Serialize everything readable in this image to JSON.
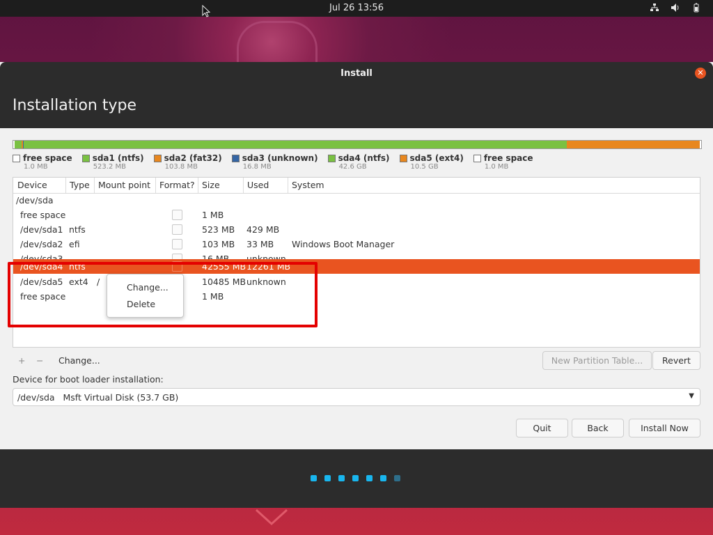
{
  "topbar": {
    "clock": "Jul 26  13:56",
    "icons": [
      "network-icon",
      "volume-icon",
      "battery-icon"
    ]
  },
  "window": {
    "title": "Install",
    "page_title": "Installation type"
  },
  "partition_bar": [
    {
      "label": "free space",
      "size": "1.0 MB",
      "color": "#ffffff"
    },
    {
      "label": "sda1 (ntfs)",
      "size": "523.2 MB",
      "color": "#7ac142"
    },
    {
      "label": "sda2 (fat32)",
      "size": "103.8 MB",
      "color": "#e8871e"
    },
    {
      "label": "sda3 (unknown)",
      "size": "16.8 MB",
      "color": "#3465a4"
    },
    {
      "label": "sda4 (ntfs)",
      "size": "42.6 GB",
      "color": "#7ac142"
    },
    {
      "label": "sda5 (ext4)",
      "size": "10.5 GB",
      "color": "#e8871e"
    },
    {
      "label": "free space",
      "size": "1.0 MB",
      "color": "#ffffff"
    }
  ],
  "table": {
    "headers": [
      "Device",
      "Type",
      "Mount point",
      "Format?",
      "Size",
      "Used",
      "System"
    ],
    "rows": [
      {
        "device": "/dev/sda",
        "type": "",
        "mount": "",
        "format": false,
        "size": "",
        "used": "",
        "system": "",
        "group": true
      },
      {
        "device": "free space",
        "type": "",
        "mount": "",
        "format": true,
        "size": "1 MB",
        "used": "",
        "system": ""
      },
      {
        "device": "/dev/sda1",
        "type": "ntfs",
        "mount": "",
        "format": true,
        "size": "523 MB",
        "used": "429 MB",
        "system": ""
      },
      {
        "device": "/dev/sda2",
        "type": "efi",
        "mount": "",
        "format": true,
        "size": "103 MB",
        "used": "33 MB",
        "system": "Windows Boot Manager"
      },
      {
        "device": "/dev/sda3",
        "type": "",
        "mount": "",
        "format": true,
        "size": "16 MB",
        "used": "unknown",
        "system": ""
      },
      {
        "device": "/dev/sda4",
        "type": "ntfs",
        "mount": "",
        "format": true,
        "size": "42555 MB",
        "used": "12261 MB",
        "system": "",
        "selected": true
      },
      {
        "device": "/dev/sda5",
        "type": "ext4",
        "mount": "/",
        "format": true,
        "size": "10485 MB",
        "used": "unknown",
        "system": ""
      },
      {
        "device": "free space",
        "type": "",
        "mount": "",
        "format": true,
        "size": "1 MB",
        "used": "",
        "system": ""
      }
    ]
  },
  "context_menu": {
    "change": "Change...",
    "delete": "Delete"
  },
  "toolbar": {
    "add": "+",
    "remove": "−",
    "change": "Change...",
    "new_table": "New Partition Table...",
    "revert": "Revert"
  },
  "bootloader": {
    "label": "Device for boot loader installation:",
    "value": "/dev/sda   Msft Virtual Disk (53.7 GB)"
  },
  "buttons": {
    "quit": "Quit",
    "back": "Back",
    "install": "Install Now"
  },
  "progress": {
    "steps_total": 7,
    "steps_done": 6
  }
}
